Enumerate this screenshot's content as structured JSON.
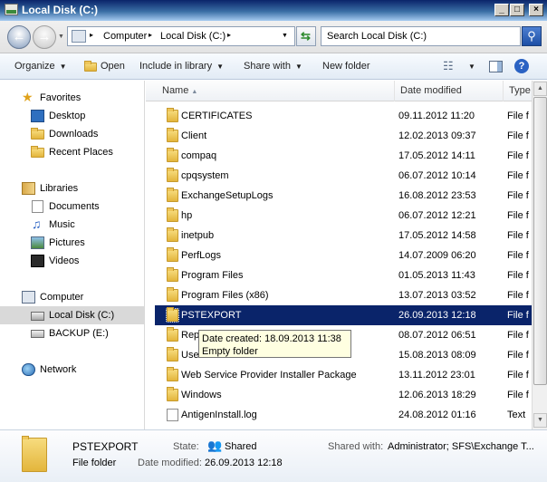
{
  "window": {
    "title": "Local Disk (C:)",
    "controls": [
      "_",
      "□",
      "×"
    ]
  },
  "address": {
    "crumbs": [
      "Computer",
      "Local Disk (C:)"
    ],
    "search_placeholder": "Search Local Disk (C:)"
  },
  "toolbar": {
    "organize": "Organize",
    "open": "Open",
    "include": "Include in library",
    "share": "Share with",
    "new_folder": "New folder"
  },
  "nav": {
    "favorites": "Favorites",
    "desktop": "Desktop",
    "downloads": "Downloads",
    "recent": "Recent Places",
    "libraries": "Libraries",
    "documents": "Documents",
    "music": "Music",
    "pictures": "Pictures",
    "videos": "Videos",
    "computer": "Computer",
    "local_disk": "Local Disk (C:)",
    "backup": "BACKUP (E:)",
    "network": "Network"
  },
  "columns": {
    "name": "Name",
    "date": "Date modified",
    "type": "Type"
  },
  "rows": [
    {
      "name": "CERTIFICATES",
      "date": "09.11.2012 11:20",
      "type": "File f"
    },
    {
      "name": "Client",
      "date": "12.02.2013 09:37",
      "type": "File f"
    },
    {
      "name": "compaq",
      "date": "17.05.2012 14:11",
      "type": "File f"
    },
    {
      "name": "cpqsystem",
      "date": "06.07.2012 10:14",
      "type": "File f"
    },
    {
      "name": "ExchangeSetupLogs",
      "date": "16.08.2012 23:53",
      "type": "File f"
    },
    {
      "name": "hp",
      "date": "06.07.2012 12:21",
      "type": "File f"
    },
    {
      "name": "inetpub",
      "date": "17.05.2012 14:58",
      "type": "File f"
    },
    {
      "name": "PerfLogs",
      "date": "14.07.2009 06:20",
      "type": "File f"
    },
    {
      "name": "Program Files",
      "date": "01.05.2013 11:43",
      "type": "File f"
    },
    {
      "name": "Program Files (x86)",
      "date": "13.07.2013 03:52",
      "type": "File f"
    },
    {
      "name": "PSTEXPORT",
      "date": "26.09.2013 12:18",
      "type": "File f"
    },
    {
      "name": "Rep",
      "date": "08.07.2012 06:51",
      "type": "File f"
    },
    {
      "name": "Users",
      "date": "15.08.2013 08:09",
      "type": "File f"
    },
    {
      "name": "Web Service Provider Installer Package",
      "date": "13.11.2012 23:01",
      "type": "File f"
    },
    {
      "name": "Windows",
      "date": "12.06.2013 18:29",
      "type": "File f"
    },
    {
      "name": "AntigenInstall.log",
      "date": "24.08.2012 01:16",
      "type": "Text"
    }
  ],
  "tooltip": {
    "line1": "Date created: 18.09.2013 11:38",
    "line2": "Empty folder"
  },
  "details": {
    "name": "PSTEXPORT",
    "kind": "File folder",
    "state_label": "State:",
    "state_value": "Shared",
    "modified_label": "Date modified:",
    "modified_value": "26.09.2013 12:18",
    "shared_label": "Shared with:",
    "shared_value": "Administrator; SFS\\Exchange T..."
  }
}
